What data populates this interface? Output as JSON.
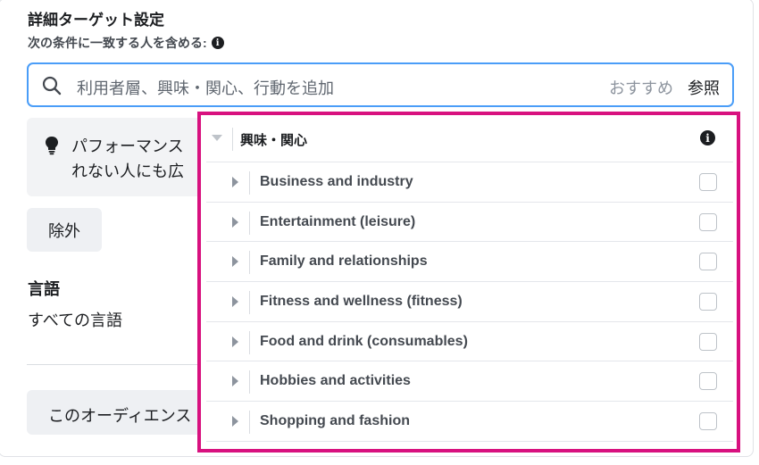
{
  "section": {
    "title": "詳細ターゲット設定",
    "subtitle": "次の条件に一致する人を含める:",
    "info_glyph": "i"
  },
  "search": {
    "placeholder": "利用者層、興味・関心、行動を追加",
    "suggestions_label": "おすすめ",
    "browse_label": "参照"
  },
  "tip": {
    "line1": "パフォーマンス",
    "line2": "れない人にも広"
  },
  "exclude_label": "除外",
  "language": {
    "title": "言語",
    "value": "すべての言語"
  },
  "audience_button_label": "このオーディエンス",
  "dropdown": {
    "category": "興味・関心",
    "info_glyph": "i",
    "items": [
      {
        "label": "Business and industry"
      },
      {
        "label": "Entertainment (leisure)"
      },
      {
        "label": "Family and relationships"
      },
      {
        "label": "Fitness and wellness (fitness)"
      },
      {
        "label": "Food and drink (consumables)"
      },
      {
        "label": "Hobbies and activities"
      },
      {
        "label": "Shopping and fashion"
      }
    ]
  },
  "colors": {
    "search_border": "#4a9df8",
    "highlight_border": "#d8117f",
    "button_bg": "#eef0f3"
  }
}
